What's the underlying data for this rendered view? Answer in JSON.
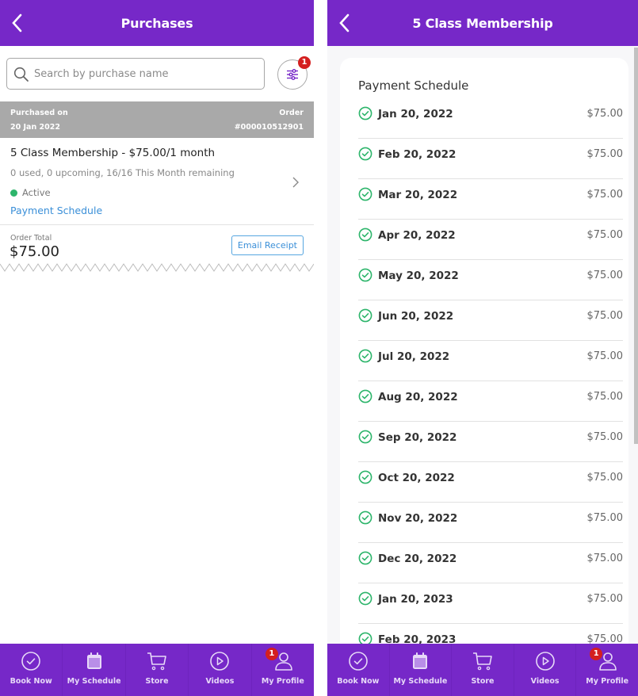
{
  "left_screen": {
    "header": {
      "title": "Purchases",
      "back_icon": "chevron-left-icon"
    },
    "search": {
      "placeholder": "Search by purchase name",
      "value": ""
    },
    "filter": {
      "badge_count": "1",
      "icon": "sliders-icon"
    },
    "order_header": {
      "purchased_on_label": "Purchased on",
      "purchased_on_value": "20 Jan 2022",
      "order_label": "Order",
      "order_value": "#000010512901"
    },
    "purchase": {
      "name": "5 Class Membership - $75.00/1 month",
      "usage": "0 used, 0 upcoming, 16/16 This Month remaining",
      "status": "Active",
      "status_color": "#2db56b",
      "payment_schedule_link": "Payment Schedule"
    },
    "order_total": {
      "label": "Order Total",
      "amount": "$75.00",
      "email_receipt_label": "Email Receipt"
    }
  },
  "right_screen": {
    "header": {
      "title": "5 Class Membership",
      "back_icon": "chevron-left-icon"
    },
    "card": {
      "heading": "Payment Schedule",
      "rows": [
        {
          "date": "Jan 20, 2022",
          "amount": "$75.00"
        },
        {
          "date": "Feb 20, 2022",
          "amount": "$75.00"
        },
        {
          "date": "Mar 20, 2022",
          "amount": "$75.00"
        },
        {
          "date": "Apr 20, 2022",
          "amount": "$75.00"
        },
        {
          "date": "May 20, 2022",
          "amount": "$75.00"
        },
        {
          "date": "Jun 20, 2022",
          "amount": "$75.00"
        },
        {
          "date": "Jul 20, 2022",
          "amount": "$75.00"
        },
        {
          "date": "Aug 20, 2022",
          "amount": "$75.00"
        },
        {
          "date": "Sep 20, 2022",
          "amount": "$75.00"
        },
        {
          "date": "Oct 20, 2022",
          "amount": "$75.00"
        },
        {
          "date": "Nov 20, 2022",
          "amount": "$75.00"
        },
        {
          "date": "Dec 20, 2022",
          "amount": "$75.00"
        },
        {
          "date": "Jan 20, 2023",
          "amount": "$75.00"
        },
        {
          "date": "Feb 20, 2023",
          "amount": "$75.00"
        }
      ]
    }
  },
  "nav": {
    "items": [
      {
        "label": "Book Now",
        "icon": "check-circle-icon"
      },
      {
        "label": "My Schedule",
        "icon": "calendar-icon"
      },
      {
        "label": "Store",
        "icon": "cart-icon"
      },
      {
        "label": "Videos",
        "icon": "play-circle-icon"
      },
      {
        "label": "My Profile",
        "icon": "user-icon",
        "badge": "1"
      }
    ]
  },
  "colors": {
    "brand": "#7628c8",
    "link": "#3a8fd8",
    "success": "#2db56b",
    "badge": "#d41f1f"
  }
}
